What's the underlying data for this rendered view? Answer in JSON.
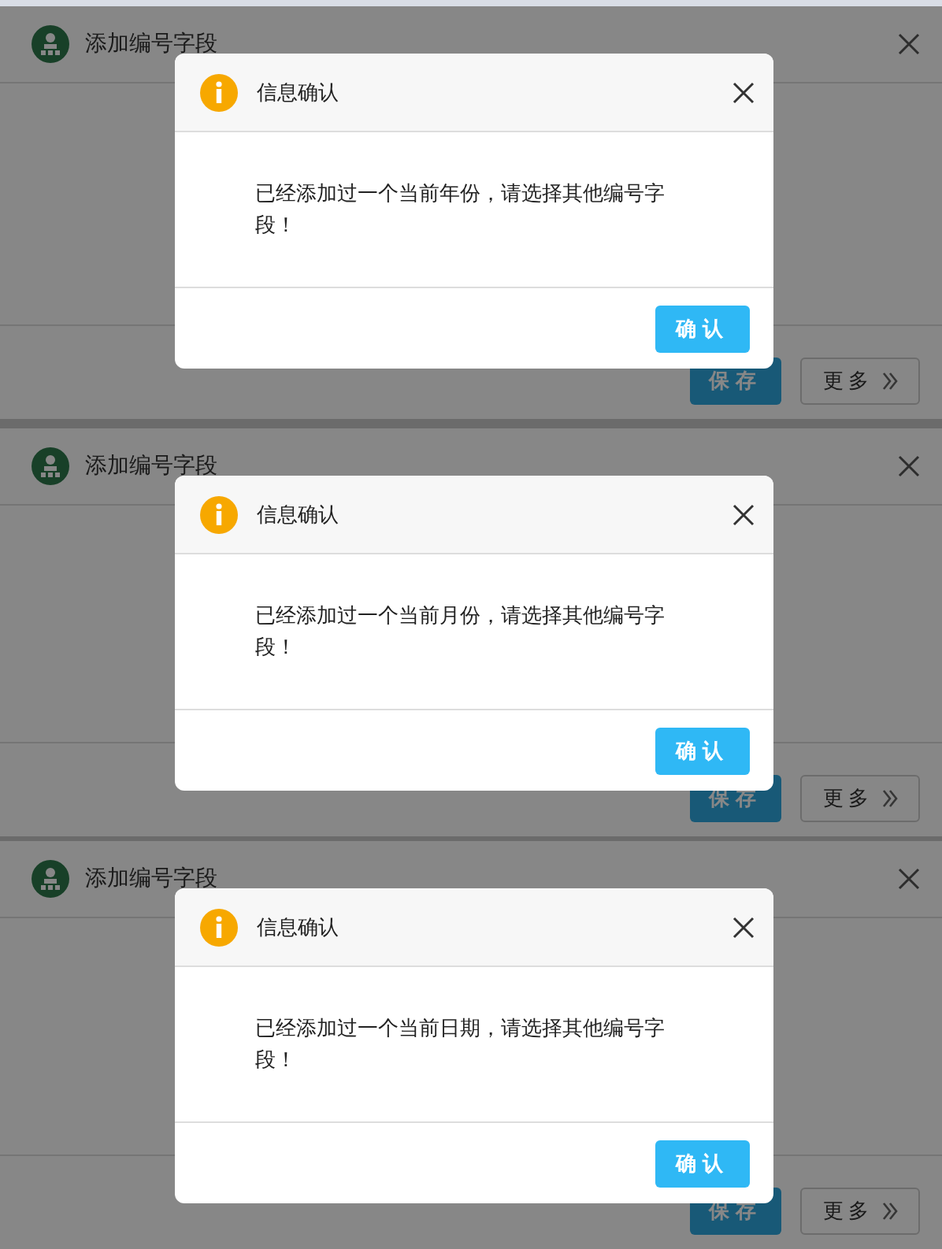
{
  "panels": [
    {
      "dialog": {
        "title": "添加编号字段",
        "save_button": "保存",
        "more_button": "更多"
      },
      "modal": {
        "title": "信息确认",
        "message": "已经添加过一个当前年份，请选择其他编号字段！",
        "confirm_button": "确认"
      }
    },
    {
      "dialog": {
        "title": "添加编号字段",
        "save_button": "保存",
        "more_button": "更多"
      },
      "modal": {
        "title": "信息确认",
        "message": "已经添加过一个当前月份，请选择其他编号字段！",
        "confirm_button": "确认"
      }
    },
    {
      "dialog": {
        "title": "添加编号字段",
        "save_button": "保存",
        "more_button": "更多"
      },
      "modal": {
        "title": "信息确认",
        "message": "已经添加过一个当前日期，请选择其他编号字段！",
        "confirm_button": "确认"
      }
    }
  ]
}
